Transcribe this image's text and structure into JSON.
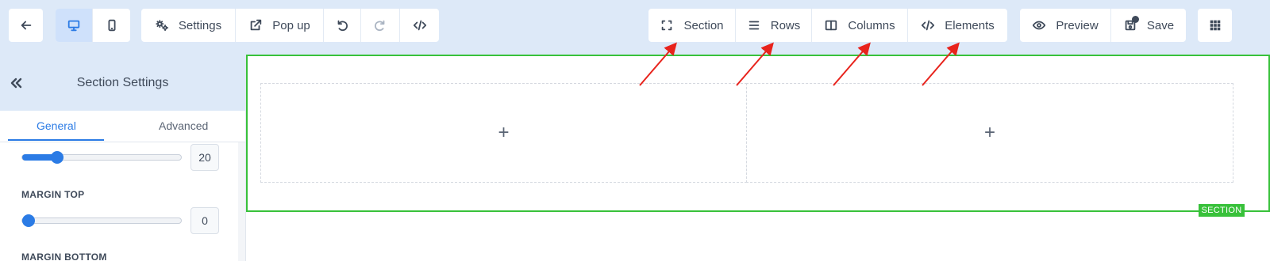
{
  "toolbar": {
    "settings_label": "Settings",
    "popup_label": "Pop up",
    "section_label": "Section",
    "rows_label": "Rows",
    "columns_label": "Columns",
    "elements_label": "Elements",
    "preview_label": "Preview",
    "save_label": "Save",
    "active_device": "desktop",
    "icons": [
      "back-arrow-icon",
      "desktop-icon",
      "mobile-icon",
      "gears-icon",
      "external-link-icon",
      "undo-icon",
      "redo-icon",
      "code-icon",
      "section-icon",
      "rows-icon",
      "columns-icon",
      "code-icon",
      "eye-icon",
      "save-icon",
      "grid-icon"
    ]
  },
  "sidebar": {
    "title": "Section Settings",
    "tabs": [
      {
        "label": "General",
        "active": true
      },
      {
        "label": "Advanced",
        "active": false
      }
    ],
    "fields": [
      {
        "label": "",
        "value": "20",
        "level": 0.22
      },
      {
        "label": "MARGIN TOP",
        "value": "0",
        "level": 0
      },
      {
        "label": "MARGIN BOTTOM"
      }
    ]
  },
  "canvas": {
    "section_tag": "SECTION",
    "columns": [
      {
        "add_symbol": "+"
      },
      {
        "add_symbol": "+"
      }
    ]
  },
  "colors": {
    "accent": "#2b7be5",
    "toolbar_bg": "#dde9f8",
    "section_outline": "#38c13a",
    "annotation_arrow": "#e8231c"
  }
}
